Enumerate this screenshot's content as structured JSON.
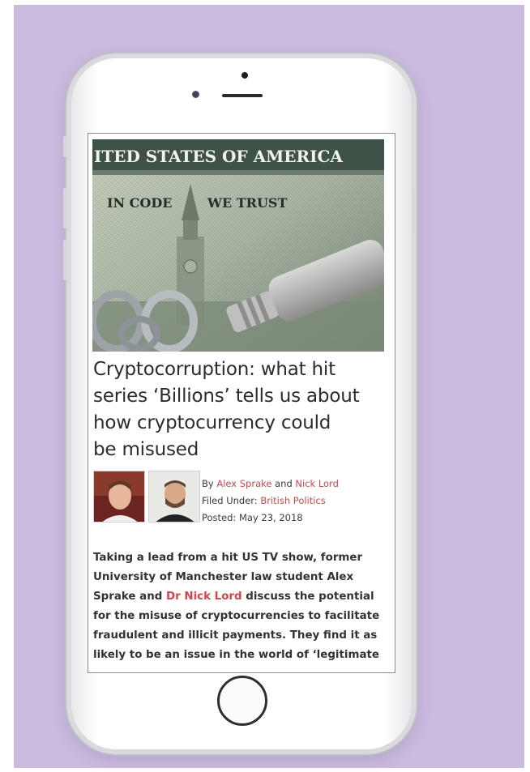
{
  "article": {
    "hero_image_alt": "US banknote with USB cable and padlock",
    "hero_text_top": "ITED STATES OF AMERICA",
    "hero_text_in_code": "IN CODE",
    "hero_text_we_trust": "WE TRUST",
    "title_lines": [
      "Cryptocorruption: what hit",
      "series ‘Billions’ tells us about",
      "how cryptocurrency could",
      "be misused"
    ],
    "byline_prefix": "By ",
    "author_1": "Alex Sprake",
    "byline_and": " and ",
    "author_2": "Nick Lord",
    "filed_under_label": "Filed Under: ",
    "category": "British Politics",
    "posted_label": "Posted: ",
    "posted_date": "May 23, 2018",
    "intro_part_1": "Taking a lead from a hit US TV show, former University of Manchester law student Alex Sprake and ",
    "intro_link": "Dr Nick Lord",
    "intro_part_2": " discuss the potential for the misuse of cryptocurrencies to facilitate fraudulent and illicit payments. They find it as likely to be an issue in the world of ‘legitimate"
  },
  "colors": {
    "background": "#c9bade",
    "link": "#d6444b",
    "text": "#333333"
  }
}
